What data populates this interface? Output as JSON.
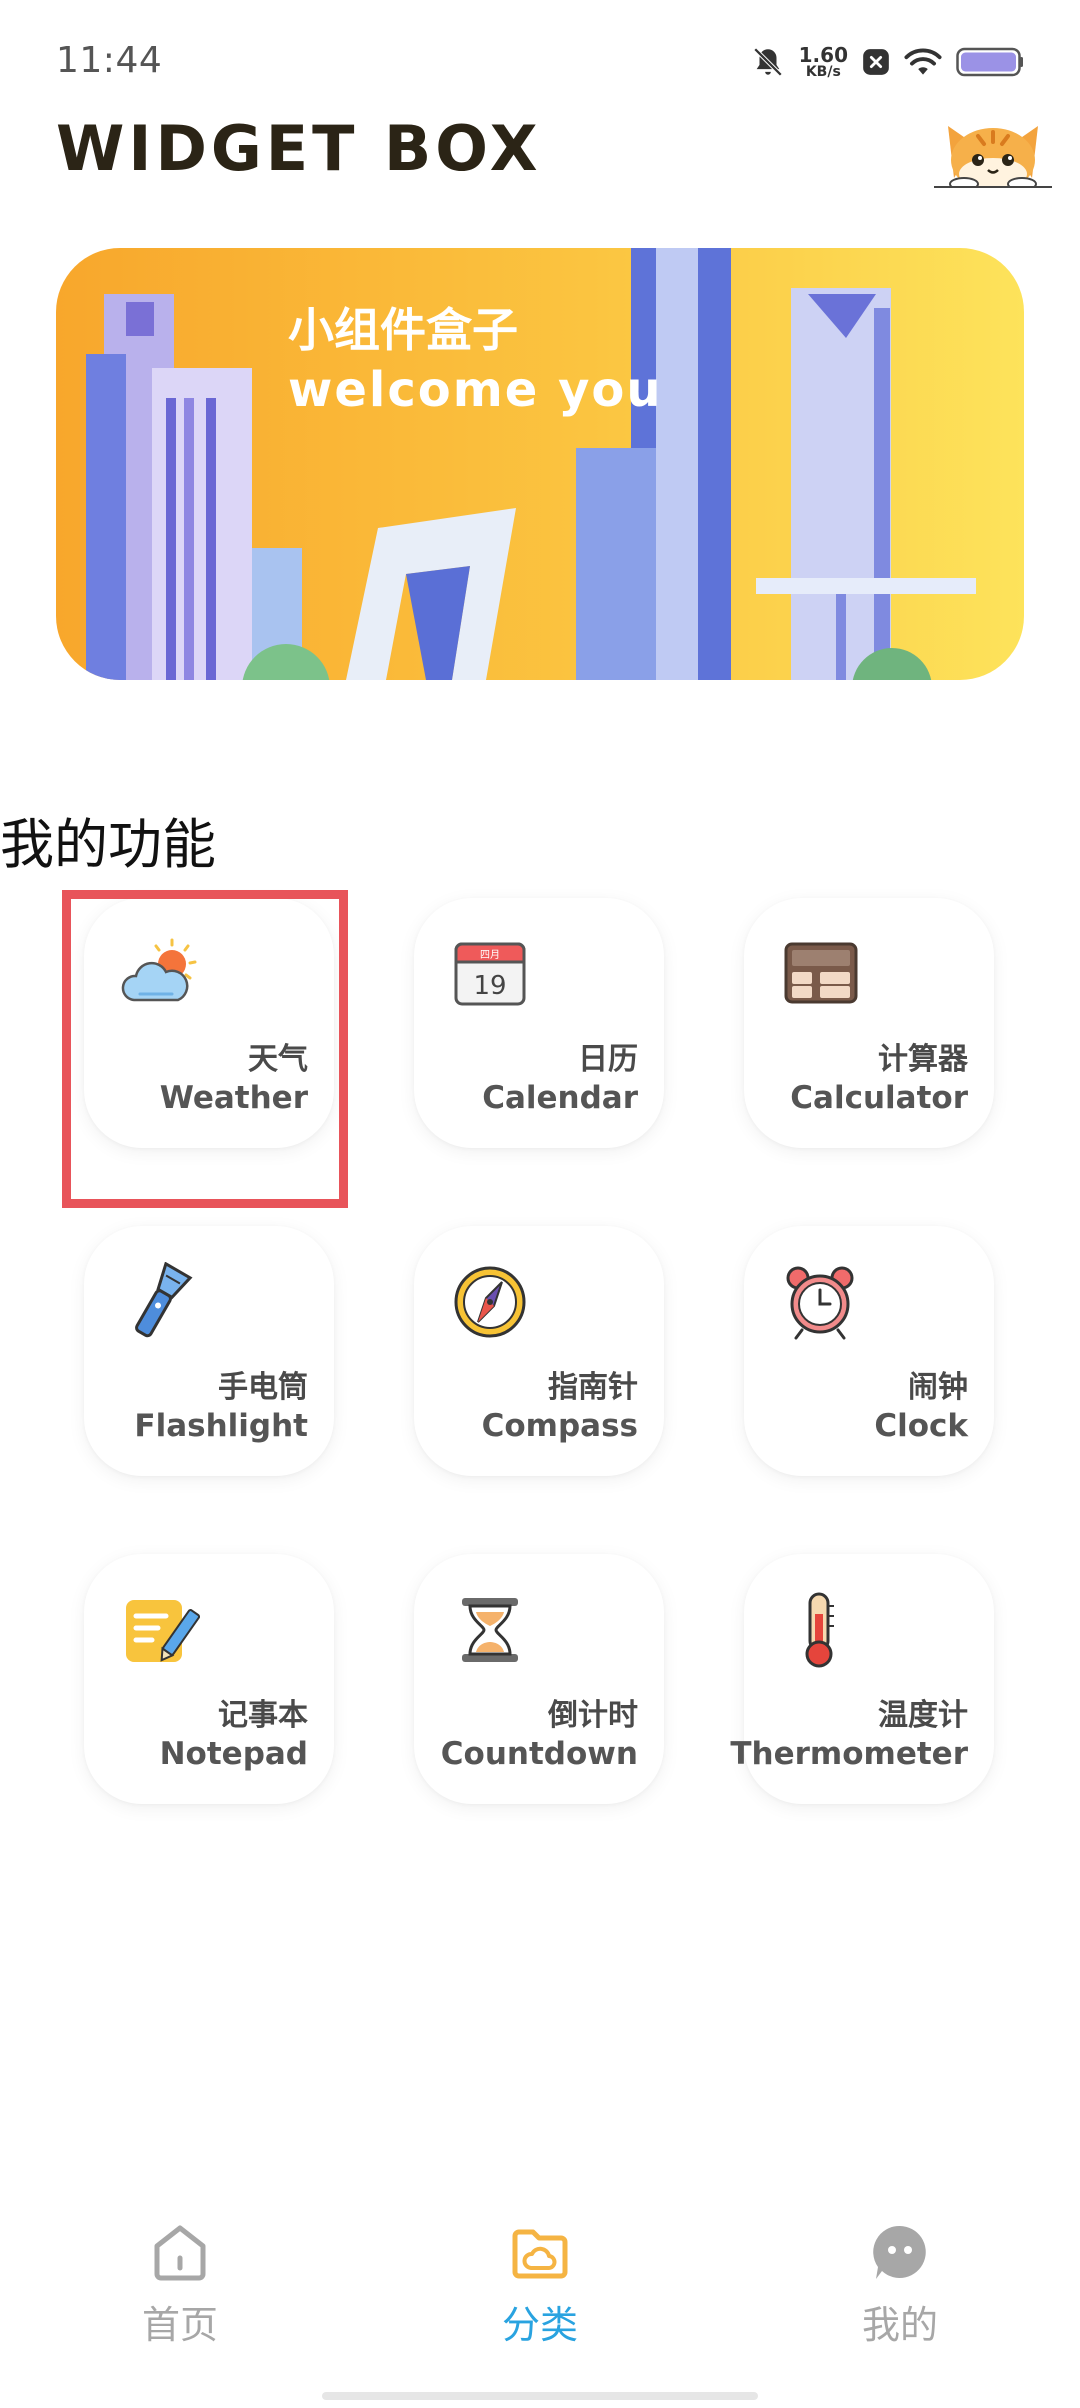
{
  "status_bar": {
    "time": "11:44",
    "net_speed_value": "1.60",
    "net_speed_unit": "KB/s",
    "icons": [
      "mute-bell-icon",
      "close-box-icon",
      "wifi-icon",
      "battery-icon"
    ]
  },
  "header": {
    "title": "WIDGET BOX"
  },
  "banner": {
    "line1": "小组件盒子",
    "line2": "welcome you"
  },
  "section": {
    "title": "我的功能"
  },
  "features": [
    {
      "cn": "天气",
      "en": "Weather",
      "icon": "weather-icon"
    },
    {
      "cn": "日历",
      "en": "Calendar",
      "icon": "calendar-icon",
      "calendar_day": "19",
      "calendar_month": "四月"
    },
    {
      "cn": "计算器",
      "en": "Calculator",
      "icon": "calculator-icon"
    },
    {
      "cn": "手电筒",
      "en": "Flashlight",
      "icon": "flashlight-icon"
    },
    {
      "cn": "指南针",
      "en": "Compass",
      "icon": "compass-icon"
    },
    {
      "cn": "闹钟",
      "en": "Clock",
      "icon": "alarm-clock-icon"
    },
    {
      "cn": "记事本",
      "en": "Notepad",
      "icon": "notepad-icon"
    },
    {
      "cn": "倒计时",
      "en": "Countdown",
      "icon": "hourglass-icon"
    },
    {
      "cn": "温度计",
      "en": "Thermometer",
      "icon": "thermometer-icon"
    }
  ],
  "bottom_nav": {
    "items": [
      {
        "label": "首页",
        "icon": "home-icon",
        "active": false
      },
      {
        "label": "分类",
        "icon": "folder-cloud-icon",
        "active": true
      },
      {
        "label": "我的",
        "icon": "profile-icon",
        "active": false
      }
    ],
    "active_color": "#29a3e0",
    "inactive_color": "#a7a7a7"
  },
  "colors": {
    "highlight_border": "#e8545a",
    "banner_orange": "#f8a72c",
    "banner_yellow": "#fde35b"
  }
}
